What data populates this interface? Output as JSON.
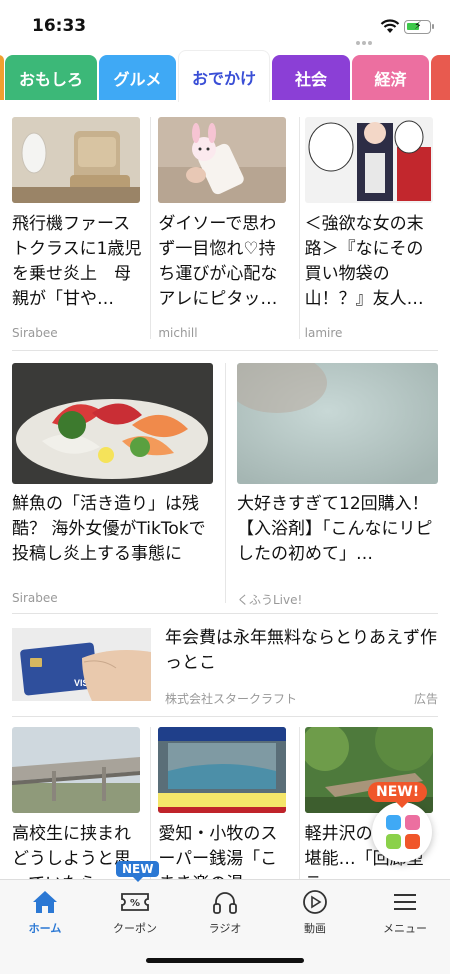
{
  "status_bar": {
    "time": "16:33"
  },
  "tabs": [
    {
      "label": "おもしろ",
      "color": "#3cb878"
    },
    {
      "label": "グルメ",
      "color": "#3fa9f5"
    },
    {
      "label": "おでかけ",
      "color": "#3a4fd6",
      "active": true
    },
    {
      "label": "社会",
      "color": "#8b3fd6"
    },
    {
      "label": "経済",
      "color": "#ec6fa0"
    }
  ],
  "articles_row1": [
    {
      "title": "飛行機ファーストクラスに1歳児を乗せ炎上　母親が「甘や…",
      "source": "Sirabee",
      "thumb": "airplane-first-class-seat"
    },
    {
      "title": "ダイソーで思わず一目惚れ♡持ち運びが心配なアレにピタッ…",
      "source": "michill",
      "thumb": "melody-character-case"
    },
    {
      "title": "＜強欲な女の末路＞『なにその買い物袋の山！？』友人…",
      "source": "lamire",
      "thumb": "manga-panel"
    }
  ],
  "articles_row2": [
    {
      "title": "鮮魚の「活き造り」は残酷？ 海外女優がTikTokで投稿し炎上する事態に",
      "source": "Sirabee",
      "thumb": "sashimi-platter"
    },
    {
      "title": "大好きすぎて12回購入！【入浴剤】「こんなにリピしたの初めて」…",
      "source": "くふうLive!",
      "thumb": "bath-water"
    }
  ],
  "ad": {
    "title": "年会費は永年無料ならとりあえず作っとこ",
    "advertiser": "株式会社スタークラフト",
    "label": "広告",
    "thumb": "credit-card-in-hand",
    "card_brand": "VISA"
  },
  "articles_row3": [
    {
      "title": "高校生に挟まれどうしようと思っていたら…",
      "thumb": "highway-overpass"
    },
    {
      "title": "愛知・小牧のスーパー銭湯「こまき楽の湯」は…",
      "thumb": "sento-tv-screen"
    },
    {
      "title": "軽井沢の…間を堪能…「回廊型テ…",
      "thumb": "forest-walkway"
    }
  ],
  "fab": {
    "new_label": "NEW!",
    "colors": [
      "#3fa9f5",
      "#ec6fa0",
      "#8bd14a",
      "#f0562a"
    ]
  },
  "bottom_nav": {
    "new_badge": "NEW",
    "items": [
      {
        "label": "ホーム",
        "icon": "home-icon",
        "active": true
      },
      {
        "label": "クーポン",
        "icon": "coupon-icon"
      },
      {
        "label": "ラジオ",
        "icon": "headphones-icon"
      },
      {
        "label": "動画",
        "icon": "play-icon"
      },
      {
        "label": "メニュー",
        "icon": "menu-icon"
      }
    ]
  },
  "colors": {
    "accent": "#2b78d4",
    "active_tab": "#3a4fd6"
  }
}
